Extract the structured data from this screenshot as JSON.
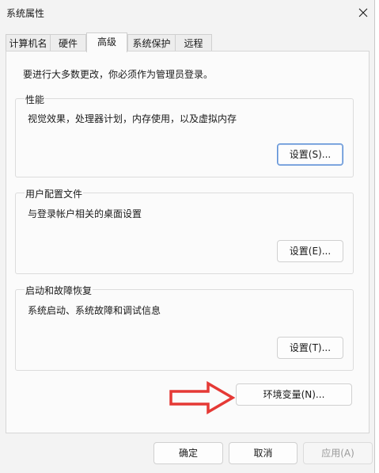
{
  "window": {
    "title": "系统属性",
    "close_icon": "close-icon"
  },
  "tabs": [
    {
      "label": "计算机名",
      "active": false
    },
    {
      "label": "硬件",
      "active": false
    },
    {
      "label": "高级",
      "active": true
    },
    {
      "label": "系统保护",
      "active": false
    },
    {
      "label": "远程",
      "active": false
    }
  ],
  "advanced": {
    "intro": "要进行大多数更改，你必须作为管理员登录。",
    "performance": {
      "title": "性能",
      "description": "视觉效果，处理器计划，内存使用，以及虚拟内存",
      "settings_label": "设置(S)..."
    },
    "user_profiles": {
      "title": "用户配置文件",
      "description": "与登录帐户相关的桌面设置",
      "settings_label": "设置(E)..."
    },
    "startup_recovery": {
      "title": "启动和故障恢复",
      "description": "系统启动、系统故障和调试信息",
      "settings_label": "设置(T)..."
    },
    "env_vars_label": "环境变量(N)..."
  },
  "footer": {
    "ok_label": "确定",
    "cancel_label": "取消",
    "apply_label": "应用(A)"
  },
  "annotation": {
    "arrow_icon": "right-arrow-icon",
    "arrow_color": "#e53935"
  }
}
